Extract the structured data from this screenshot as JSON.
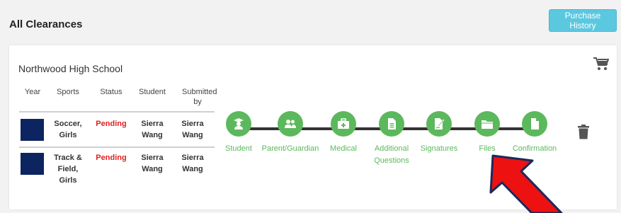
{
  "header": {
    "title": "All Clearances",
    "purchase_history_label": "Purchase History"
  },
  "card": {
    "school_name": "Northwood High School",
    "columns": [
      "Year",
      "Sports",
      "Status",
      "Student",
      "Submitted by"
    ],
    "rows": [
      {
        "sport": "Soccer, Girls",
        "status": "Pending",
        "student": "Sierra Wang",
        "submitted_by": "Sierra Wang"
      },
      {
        "sport": "Track & Field, Girls",
        "status": "Pending",
        "student": "Sierra Wang",
        "submitted_by": "Sierra Wang"
      }
    ],
    "steps": [
      {
        "label": "Student",
        "icon": "student-icon"
      },
      {
        "label": "Parent/Guardian",
        "icon": "parents-icon"
      },
      {
        "label": "Medical",
        "icon": "medkit-icon"
      },
      {
        "label": "Additional Questions",
        "icon": "document-icon"
      },
      {
        "label": "Signatures",
        "icon": "signature-icon"
      },
      {
        "label": "Files",
        "icon": "folder-icon"
      },
      {
        "label": "Confirmation",
        "icon": "file-icon"
      }
    ]
  },
  "colors": {
    "step_green": "#5cb85c",
    "pending_red": "#e02020",
    "year_navy": "#0c2460",
    "button_cyan": "#5bc8df",
    "arrow_red": "#ee1111"
  }
}
